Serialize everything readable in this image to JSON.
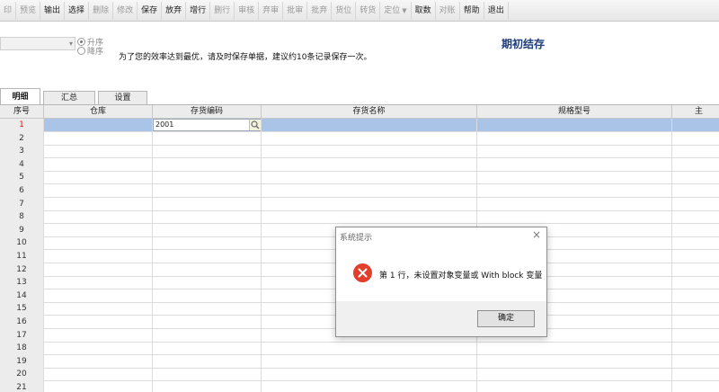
{
  "toolbar": {
    "items": [
      {
        "label": "印",
        "enabled": false
      },
      {
        "label": "预览",
        "enabled": false
      },
      {
        "label": "输出",
        "enabled": true
      },
      {
        "label": "选择",
        "enabled": true
      },
      {
        "label": "删除",
        "enabled": false
      },
      {
        "label": "修改",
        "enabled": false
      },
      {
        "label": "保存",
        "enabled": true
      },
      {
        "label": "放弃",
        "enabled": true
      },
      {
        "label": "增行",
        "enabled": true
      },
      {
        "label": "删行",
        "enabled": false
      },
      {
        "label": "审核",
        "enabled": false
      },
      {
        "label": "弃审",
        "enabled": false
      },
      {
        "label": "批审",
        "enabled": false
      },
      {
        "label": "批弃",
        "enabled": false
      },
      {
        "label": "货位",
        "enabled": false
      },
      {
        "label": "转货",
        "enabled": false
      },
      {
        "label": "定位",
        "enabled": false,
        "dropdown": true
      },
      {
        "label": "取数",
        "enabled": true
      },
      {
        "label": "对账",
        "enabled": false
      },
      {
        "label": "帮助",
        "enabled": true
      },
      {
        "label": "退出",
        "enabled": true
      }
    ]
  },
  "header": {
    "sort_asc": "升序",
    "sort_desc": "降序",
    "hint": "为了您的效率达到最优，请及时保存单据，建议约10条记录保存一次。",
    "title": "期初结存"
  },
  "tabs": [
    {
      "label": "明细",
      "active": true
    },
    {
      "label": "汇总",
      "active": false
    },
    {
      "label": "设置",
      "active": false
    }
  ],
  "grid": {
    "columns": [
      "序号",
      "仓库",
      "存货编码",
      "存货名称",
      "规格型号",
      "主"
    ],
    "rows": [
      "1",
      "2",
      "3",
      "4",
      "5",
      "6",
      "7",
      "8",
      "9",
      "10",
      "11",
      "12",
      "13",
      "14",
      "15",
      "16",
      "17",
      "18",
      "19",
      "20",
      "21"
    ],
    "selected_row_code": "2001"
  },
  "dialog": {
    "title": "系统提示",
    "message": "第 1 行，未设置对象变量或 With block 变量",
    "ok_label": "确定"
  },
  "colors": {
    "selected_row": "#a9c4e6",
    "title_blue": "#1f3d7a",
    "error_red": "#e23e2c",
    "row_number_red": "#d21f1f"
  }
}
